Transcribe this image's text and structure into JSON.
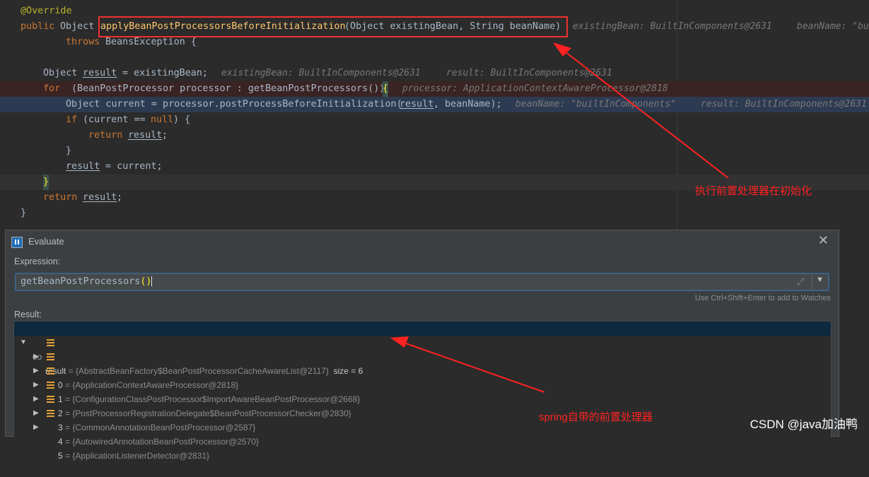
{
  "editor": {
    "override": "@Override",
    "l2_public": "public ",
    "l2_object": "Object ",
    "l2_method": "applyBeanPostProcessorsBeforeInitialization",
    "l2_params": "(Object existingBean, String beanName)",
    "l2_hint1": "existingBean: BuiltInComponents@2631",
    "l2_hint2": "beanName: \"bu",
    "l3_throws": "throws ",
    "l3_rest": "BeansException {",
    "l5_a": "Object ",
    "l5_result": "result",
    "l5_b": " = existingBean;",
    "l5_hint1": "existingBean: BuiltInComponents@2631",
    "l5_hint2": "result: BuiltInComponents@2631",
    "l6_for": "for ",
    "l6_rest": "(BeanPostProcessor processor : getBeanPostProcessors()) ",
    "l6_brace": "{",
    "l6_hint": "processor: ApplicationContextAwareProcessor@2818",
    "l7_a": "Object current = processor.postProcessBeforeInitialization(",
    "l7_result": "result",
    "l7_b": ", beanName);",
    "l7_hint1": "beanName: \"builtInComponents\"",
    "l7_hint2": "result: BuiltInComponents@2631",
    "l8_if": "if ",
    "l8_a": "(current == ",
    "l8_null": "null",
    "l8_b": ") {",
    "l9_return": "return ",
    "l9_result": "result",
    "l9_semi": ";",
    "l10_brace": "}",
    "l11_result": "result",
    "l11_rest": " = current;",
    "l12_brace": "}",
    "l13_return": "return ",
    "l13_result": "result",
    "l13_semi": ";",
    "l14_brace": "}"
  },
  "dialog": {
    "title": "Evaluate",
    "expression_label": "Expression:",
    "expression_text": "getBeanPostProcessors",
    "expression_parens": "()",
    "hint_watches": "Use Ctrl+Shift+Enter to add to Watches",
    "result_label": "Result:",
    "root": {
      "name": "result",
      "eq": " = ",
      "value": "{AbstractBeanFactory$BeanPostProcessorCacheAwareList@2117}",
      "size": "  size = 6"
    },
    "items": [
      {
        "index": "0",
        "value": "{ApplicationContextAwareProcessor@2818}"
      },
      {
        "index": "1",
        "value": "{ConfigurationClassPostProcessor$ImportAwareBeanPostProcessor@2668}"
      },
      {
        "index": "2",
        "value": "{PostProcessorRegistrationDelegate$BeanPostProcessorChecker@2830}"
      },
      {
        "index": "3",
        "value": "{CommonAnnotationBeanPostProcessor@2587}"
      },
      {
        "index": "4",
        "value": "{AutowiredAnnotationBeanPostProcessor@2570}"
      },
      {
        "index": "5",
        "value": "{ApplicationListenerDetector@2831}"
      }
    ]
  },
  "annotations": {
    "top_note": "执行前置处理器在初始化",
    "bottom_note": "spring自带的前置处理器"
  },
  "watermark": "CSDN @java加油鸭",
  "colors": {
    "annotation_red": "#ff2222",
    "keyword": "#cc7832",
    "method": "#ffc66d",
    "annotation_yellow": "#bbb529"
  }
}
